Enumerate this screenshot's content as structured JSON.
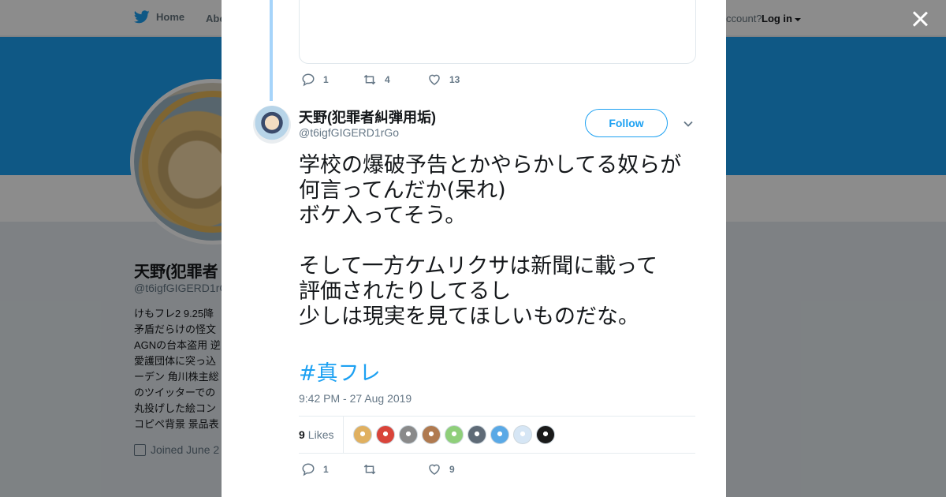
{
  "nav": {
    "home_label": "Home",
    "about_label": "Abo",
    "account_text": "ccount?",
    "login_label": "Log in"
  },
  "background_profile": {
    "name": "天野(犯罪者",
    "handle": "@t6igfGIGERD1rG",
    "bio_lines": [
      "けもフレ2 9.25降",
      "矛盾だらけの怪文",
      "AGNの台本盗用 逆",
      "愛護団体に突っ込",
      "ーデン 角川株主総",
      "のツイッターでの",
      "丸投げした絵コン",
      "コピペ背景 景品表"
    ],
    "joined": "Joined June 2"
  },
  "modal": {
    "previous_tweet": {
      "replies": "1",
      "retweets": "4",
      "likes": "13"
    },
    "tweet": {
      "display_name": "天野(犯罪者糾弾用垢)",
      "handle": "@t6igfGIGERD1rGo",
      "follow_label": "Follow",
      "text": "学校の爆破予告とかやらかしてる奴らが\n何言ってんだか(呆れ)\nボケ入ってそう。\n\nそして一方ケムリクサは新聞に載って\n評価されたりしてるし\n少しは現実を見てほしいものだな。",
      "hashtag": "#真フレ",
      "timestamp": "9:42 PM - 27 Aug 2019",
      "likes_count": "9",
      "likes_label": "Likes",
      "replies": "1",
      "retweets": "",
      "likes": "9"
    }
  },
  "colors": {
    "brand_blue": "#1da1f2",
    "thread_line": "#a6d4fa",
    "secondary_text": "#657786"
  },
  "likers": [
    {
      "color": "#e0b060"
    },
    {
      "color": "#d9443a"
    },
    {
      "color": "#8a8a8a"
    },
    {
      "color": "#b07a50"
    },
    {
      "color": "#8fcf7a"
    },
    {
      "color": "#5f6b77"
    },
    {
      "color": "#5aa9e6"
    },
    {
      "color": "#d6e6f5"
    },
    {
      "color": "#1a1a1a"
    }
  ]
}
